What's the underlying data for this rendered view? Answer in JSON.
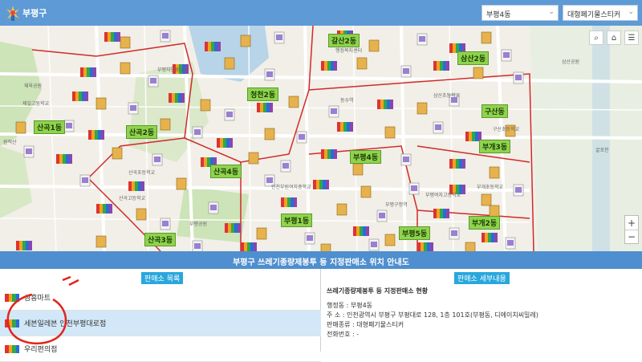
{
  "header": {
    "logo_text": "부평구",
    "dong_select": "부평4동",
    "type_select": "대형폐기물스티커"
  },
  "map": {
    "dong_labels": [
      "갈산2동",
      "삼산2동",
      "청천2동",
      "산곡1동",
      "산곡2동",
      "산곡4동",
      "구산동",
      "부평4동",
      "부개3동",
      "부평1동",
      "부개2동",
      "부평5동",
      "산곡3동"
    ],
    "place_labels": [
      "제일고등학교",
      "체육공원",
      "삼산초등학교",
      "부평자연휴양림",
      "산곡초등학교",
      "원적산",
      "구산초등학교",
      "인천부원여자중학교",
      "부개초등학교",
      "부평공원",
      "산곡고등학교",
      "삼산공원",
      "부평여자고등학교",
      "동수역",
      "부평구청역",
      "굴포천",
      "행정복지센터"
    ],
    "tools": {
      "search": "⌕",
      "home": "⌂",
      "layers": "☰"
    },
    "zoom_in": "+",
    "zoom_out": "−",
    "colors": {
      "road": "#ffffff",
      "boundary": "#d12a2a",
      "water": "#b7d4e8",
      "park": "#cde3b8",
      "building": "#e2ddd2"
    }
  },
  "title": "부평구 쓰레기종량제봉투 등 지정판매소 위치 안내도",
  "list_panel": {
    "heading": "판매소 목록",
    "items": [
      {
        "name": "삼흥마트",
        "selected": false
      },
      {
        "name": "세븐일레븐 인천부평대로점",
        "selected": true
      },
      {
        "name": "우리편의점",
        "selected": false
      }
    ]
  },
  "detail_panel": {
    "heading_tag": "판매소 세부내용",
    "title": "쓰레기종량제봉투 등 지정판매소 현황",
    "lines": [
      "행정동 : 부평4동",
      "주 소 : 인천광역시 부평구 부평대로 128, 1층 101호(부평동, 디에이치씨밀레)",
      "판매종류 : 대형폐기물스티커",
      "전화번호 : -"
    ]
  }
}
